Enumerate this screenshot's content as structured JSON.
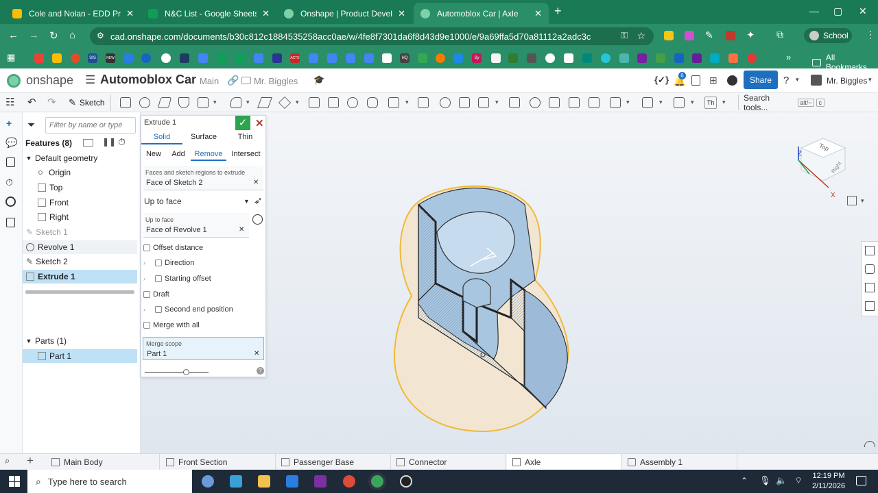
{
  "browser": {
    "tabs": [
      {
        "title": "Cole and Nolan - EDD Projects",
        "icon": "google-drive-icon",
        "color": "#fbbc04"
      },
      {
        "title": "N&C List - Google Sheets",
        "icon": "google-sheets-icon",
        "color": "#0f9d58"
      },
      {
        "title": "Onshape | Product Developmen",
        "icon": "onshape-icon",
        "color": "#7cd1a6"
      },
      {
        "title": "Automoblox Car | Axle",
        "icon": "onshape-icon",
        "color": "#7cd1a6"
      }
    ],
    "new_tab": "+",
    "url": "cad.onshape.com/documents/b30c812c1884535258acc0ae/w/4fe8f7301da6f8d43d9e1000/e/9a69ffa5d70a81112a2adc3c",
    "profile": "School",
    "all_bookmarks": "All Bookmarks",
    "bookmark_badges": [
      "SIS",
      "NEW",
      "ACTE",
      "HQ",
      "Sy"
    ]
  },
  "app": {
    "logo": "onshape",
    "doc_title": "Automoblox Car",
    "branch": "Main",
    "folder": "Mr. Biggles",
    "notif_count": "6",
    "share": "Share",
    "user": "Mr. Biggles"
  },
  "toolbar": {
    "sketch": "Sketch",
    "text_tool": "Th",
    "search": "Search tools...",
    "search_kbd": [
      "alt/~",
      "c"
    ]
  },
  "tree": {
    "filter_placeholder": "Filter by name or type",
    "features_header": "Features (8)",
    "default_geometry": "Default geometry",
    "items": [
      "Origin",
      "Top",
      "Front",
      "Right"
    ],
    "features": [
      "Sketch 1",
      "Revolve 1",
      "Sketch 2",
      "Extrude 1"
    ],
    "parts_header": "Parts (1)",
    "parts": [
      "Part 1"
    ]
  },
  "dialog": {
    "title": "Extrude 1",
    "type_tabs": [
      "Solid",
      "Surface",
      "Thin"
    ],
    "op_tabs": [
      "New",
      "Add",
      "Remove",
      "Intersect"
    ],
    "faces_label": "Faces and sketch regions to extrude",
    "faces_value": "Face of Sketch 2",
    "end_type": "Up to face",
    "up_to_face_label": "Up to face",
    "up_to_face_value": "Face of Revolve 1",
    "offset_distance": "Offset distance",
    "direction": "Direction",
    "starting_offset": "Starting offset",
    "draft": "Draft",
    "second_end": "Second end position",
    "merge_with_all": "Merge with all",
    "merge_scope_label": "Merge scope",
    "merge_scope_value": "Part 1",
    "slider_fraction": 0.65
  },
  "viewcube": {
    "face": "Top",
    "face2": "Right",
    "axis_x": "X",
    "axis_z": "Z"
  },
  "doc_tabs": [
    "Main Body",
    "Front Section",
    "Passenger Base",
    "Connector",
    "Axle",
    "Assembly 1"
  ],
  "doc_tabs_add": "+",
  "taskbar": {
    "search_placeholder": "Type here to search",
    "time": "12:19 PM",
    "date": "2/11/2026"
  },
  "colors": {
    "accent": "#2a8e68",
    "onshape_blue": "#1f6fbf",
    "selection": "#bfe1f6",
    "confirm": "#2ea44f",
    "cancel": "#c0392b"
  }
}
